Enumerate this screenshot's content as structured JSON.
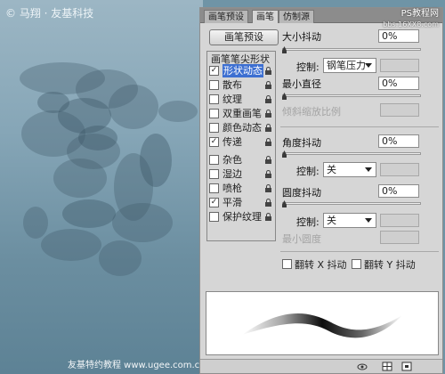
{
  "watermark": {
    "top": "© 马翔 · 友基科技",
    "bottom": "友基特约教程   www.ugee.com.cn"
  },
  "panel": {
    "tabs": [
      {
        "label": "画笔预设",
        "active": false
      },
      {
        "label": "画笔",
        "active": true
      },
      {
        "label": "仿制源",
        "active": false
      }
    ],
    "site_logo": {
      "name": "PS教程网",
      "url": "bbs.16XX8.com"
    },
    "preset_button": "画笔预设",
    "list_header": "画笔笔尖形状",
    "list_items": [
      {
        "label": "形状动态",
        "checked": true,
        "selected": true
      },
      {
        "label": "散布",
        "checked": false,
        "selected": false
      },
      {
        "label": "纹理",
        "checked": false,
        "selected": false
      },
      {
        "label": "双重画笔",
        "checked": false,
        "selected": false
      },
      {
        "label": "颜色动态",
        "checked": false,
        "selected": false
      },
      {
        "label": "传递",
        "checked": true,
        "selected": false
      },
      {
        "label": "杂色",
        "checked": false,
        "selected": false
      },
      {
        "label": "湿边",
        "checked": false,
        "selected": false
      },
      {
        "label": "喷枪",
        "checked": false,
        "selected": false
      },
      {
        "label": "平滑",
        "checked": true,
        "selected": false
      },
      {
        "label": "保护纹理",
        "checked": false,
        "selected": false
      }
    ],
    "size_jitter": {
      "label": "大小抖动",
      "value": "0%",
      "level": 0
    },
    "size_control": {
      "label": "控制:",
      "value": "钢笔压力"
    },
    "min_diameter": {
      "label": "最小直径",
      "value": "0%",
      "level": 0
    },
    "tilt_scale": {
      "label": "倾斜缩放比例"
    },
    "angle_jitter": {
      "label": "角度抖动",
      "value": "0%",
      "level": 0
    },
    "angle_control": {
      "label": "控制:",
      "value": "关"
    },
    "roundness_jitter": {
      "label": "圆度抖动",
      "value": "0%",
      "level": 0
    },
    "roundness_control": {
      "label": "控制:",
      "value": "关"
    },
    "min_roundness": {
      "label": "最小圆度"
    },
    "flip_x": {
      "label": "翻转 X 抖动",
      "checked": false
    },
    "flip_y": {
      "label": "翻转 Y 抖动",
      "checked": false
    },
    "bottom_icons": [
      "brush-view-icon",
      "grid-icon",
      "new-icon"
    ]
  },
  "colors": {
    "selection": "#3d6fd1",
    "panel_bg": "#d6d6d6",
    "canvas_top": "#9cb6c4",
    "canvas_bottom": "#5d8295"
  }
}
